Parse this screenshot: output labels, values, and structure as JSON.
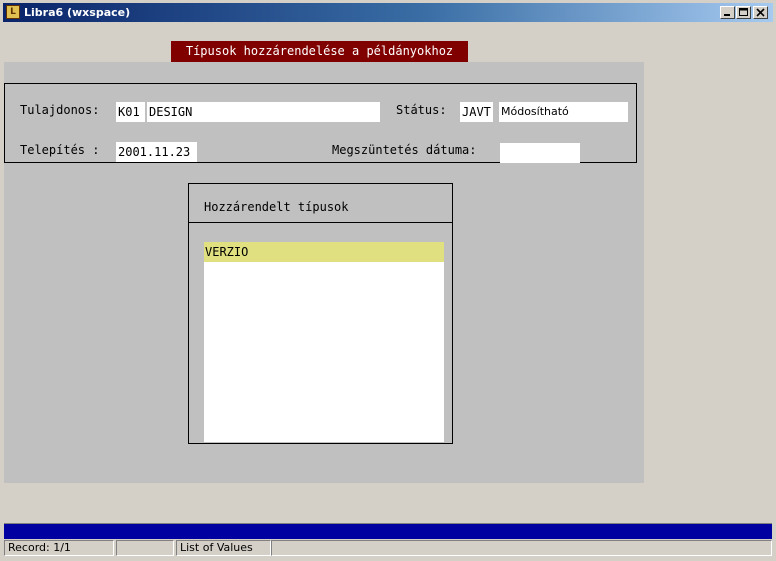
{
  "window": {
    "title": "Libra6 (wxspace)",
    "icon": "libra-app-icon",
    "controls": [
      "minimize-icon",
      "maximize-icon",
      "close-icon"
    ]
  },
  "banner": {
    "text": "Típusok hozzárendelése a példányokhoz",
    "background": "#800000"
  },
  "header": {
    "owner_label": "Tulajdonos:",
    "owner_code": "K01",
    "owner_name": "DESIGN",
    "status_label": "Státus:",
    "status_code": "JAVT",
    "status_name": "Módosítható",
    "install_label": "Telepítés :",
    "install_date": "2001.11.23",
    "end_label": "Megszüntetés dátuma:",
    "end_date": ""
  },
  "types": {
    "title": "Hozzárendelt típusok",
    "rows": [
      "VERZIO"
    ],
    "selected_color": "#e0e080"
  },
  "statusbar": {
    "record": "Record: 1/1",
    "cell2": "",
    "lov": "List of Values",
    "cell4": ""
  },
  "colors": {
    "canvas": "#c0c0c0",
    "progress": "#0000a0",
    "window_bg": "#d4d0c8"
  }
}
